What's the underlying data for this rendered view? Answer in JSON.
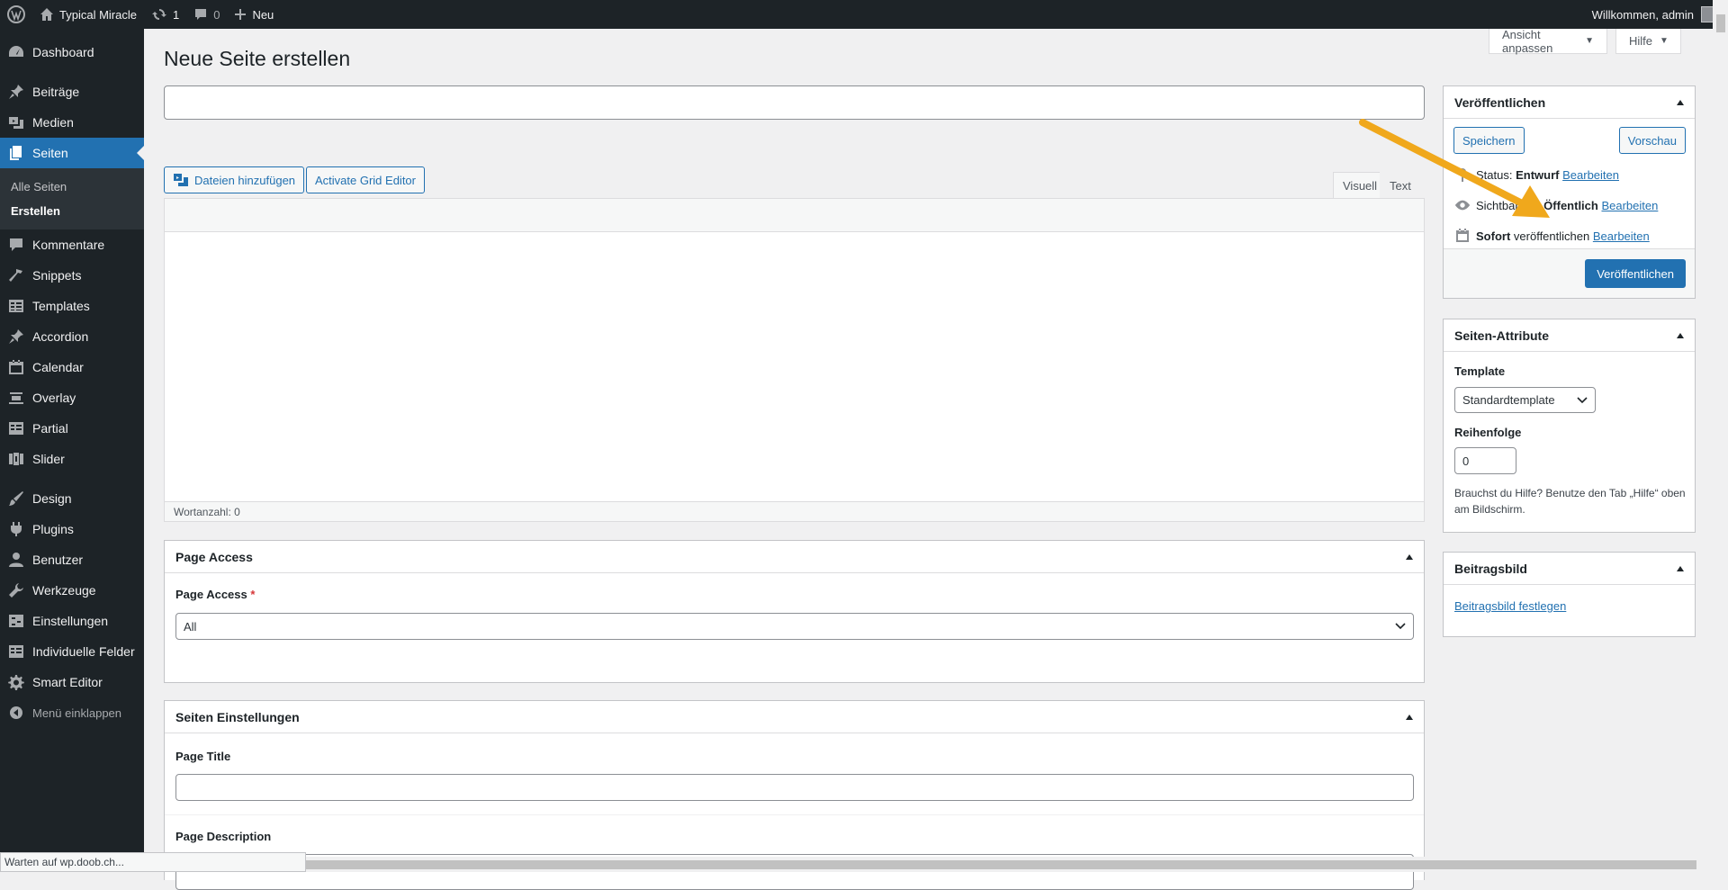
{
  "adminbar": {
    "site_name": "Typical Miracle",
    "updates_count": "1",
    "comments_count": "0",
    "new_label": "Neu",
    "welcome": "Willkommen, admin"
  },
  "sidebar": {
    "items": [
      {
        "label": "Dashboard",
        "icon": "dashboard-icon"
      },
      {
        "label": "Beiträge",
        "icon": "pin-icon"
      },
      {
        "label": "Medien",
        "icon": "media-icon"
      },
      {
        "label": "Seiten",
        "icon": "pages-icon"
      },
      {
        "label": "Kommentare",
        "icon": "comment-icon"
      },
      {
        "label": "Snippets",
        "icon": "hammer-icon"
      },
      {
        "label": "Templates",
        "icon": "table-icon"
      },
      {
        "label": "Accordion",
        "icon": "pin-icon"
      },
      {
        "label": "Calendar",
        "icon": "calendar-icon"
      },
      {
        "label": "Overlay",
        "icon": "overlay-icon"
      },
      {
        "label": "Partial",
        "icon": "table-icon"
      },
      {
        "label": "Slider",
        "icon": "slider-icon"
      },
      {
        "label": "Design",
        "icon": "brush-icon"
      },
      {
        "label": "Plugins",
        "icon": "plugin-icon"
      },
      {
        "label": "Benutzer",
        "icon": "user-icon"
      },
      {
        "label": "Werkzeuge",
        "icon": "wrench-icon"
      },
      {
        "label": "Einstellungen",
        "icon": "settings-icon"
      },
      {
        "label": "Individuelle Felder",
        "icon": "table-icon"
      },
      {
        "label": "Smart Editor",
        "icon": "gear-icon"
      }
    ],
    "submenu": [
      "Alle Seiten",
      "Erstellen"
    ],
    "collapse_label": "Menü einklappen"
  },
  "screen_meta": {
    "options_label": "Ansicht anpassen",
    "help_label": "Hilfe"
  },
  "page": {
    "title": "Neue Seite erstellen"
  },
  "editor": {
    "add_media_label": "Dateien hinzufügen",
    "grid_editor_label": "Activate Grid Editor",
    "tab_visual": "Visuell",
    "tab_text": "Text",
    "word_count": "Wortanzahl: 0"
  },
  "page_access": {
    "heading": "Page Access",
    "field_label": "Page Access",
    "required_mark": "*",
    "selected": "All"
  },
  "page_settings": {
    "heading": "Seiten Einstellungen",
    "title_label": "Page Title",
    "description_label": "Page Description"
  },
  "publish": {
    "heading": "Veröffentlichen",
    "save_label": "Speichern",
    "preview_label": "Vorschau",
    "status_prefix": "Status:",
    "status_value": "Entwurf",
    "visibility_prefix": "Sichtbarkeit:",
    "visibility_value": "Öffentlich",
    "schedule_bold": "Sofort",
    "schedule_text": "veröffentlichen",
    "edit_link": "Bearbeiten",
    "publish_label": "Veröffentlichen"
  },
  "attributes": {
    "heading": "Seiten-Attribute",
    "template_label": "Template",
    "template_selected": "Standardtemplate",
    "order_label": "Reihenfolge",
    "order_value": "0",
    "help_text": "Brauchst du Hilfe? Benutze den Tab „Hilfe“ oben am Bildschirm."
  },
  "featured": {
    "heading": "Beitragsbild",
    "set_link": "Beitragsbild festlegen"
  },
  "browser_status": "Warten auf wp.doob.ch...",
  "colors": {
    "admin_dark": "#1d2327",
    "accent_blue": "#2271b1",
    "annotation_arrow": "#f0a81c"
  }
}
